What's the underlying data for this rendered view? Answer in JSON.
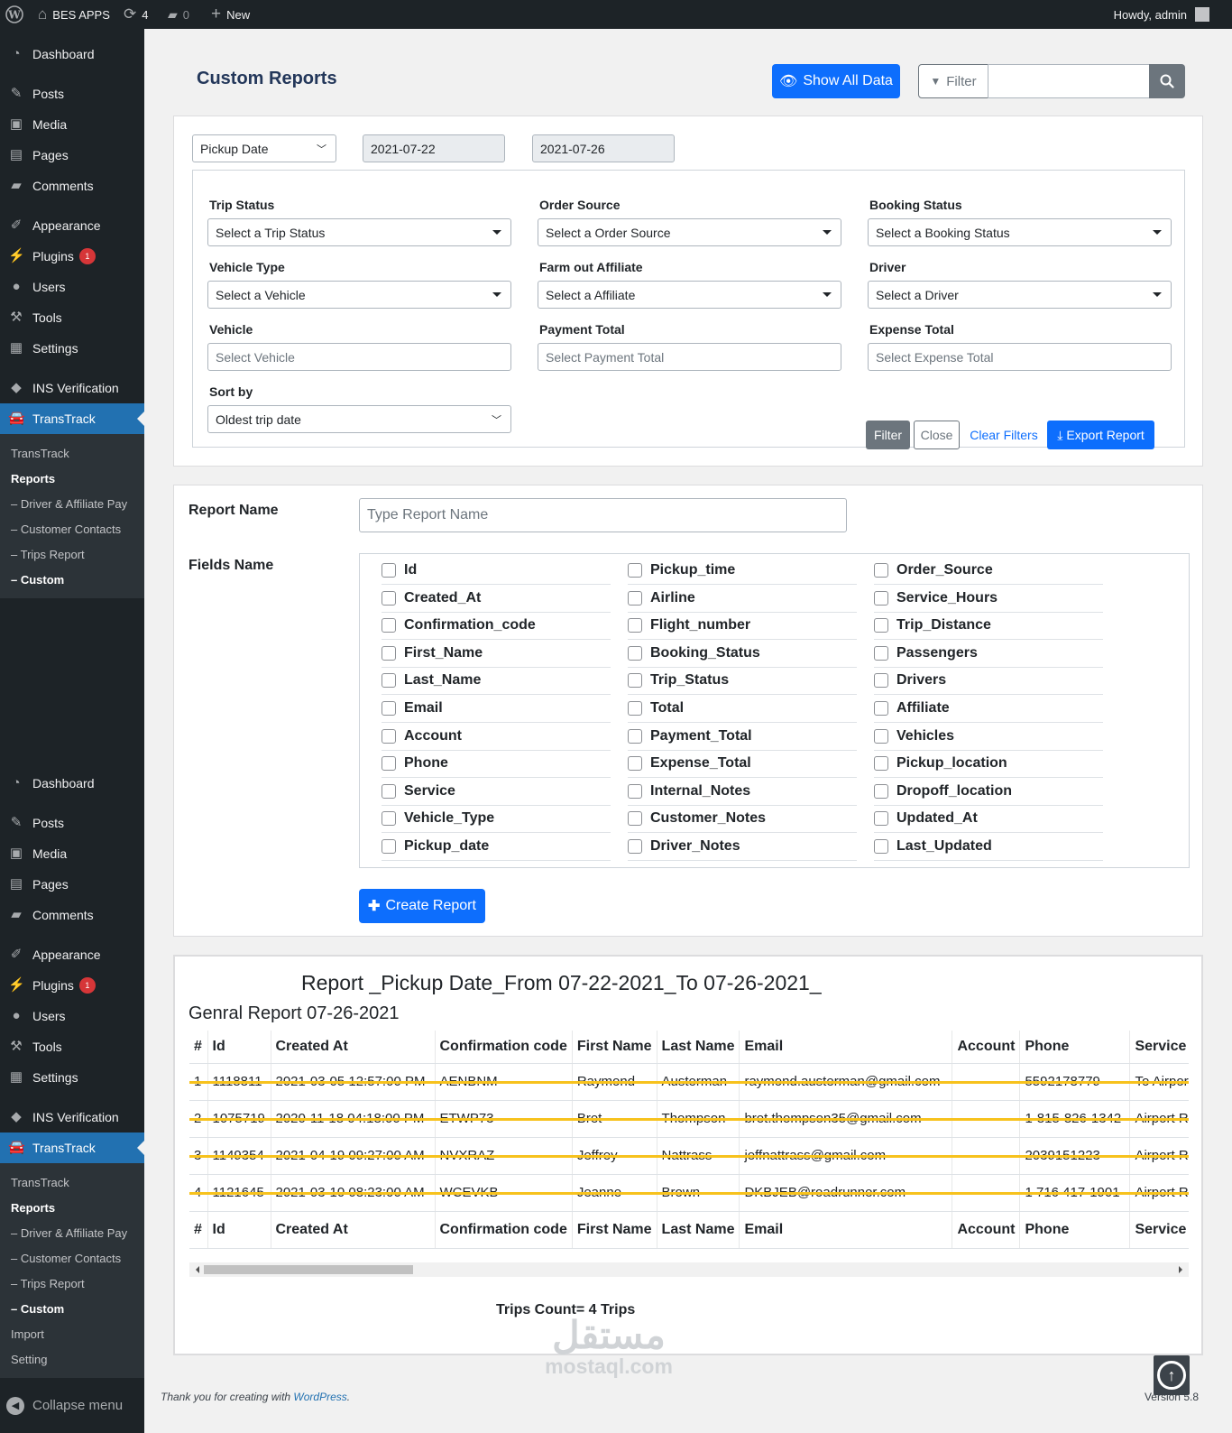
{
  "admin_bar": {
    "site_name": "BES APPS",
    "updates": "4",
    "comments": "0",
    "new_label": "New",
    "howdy": "Howdy, admin"
  },
  "sidebar": {
    "menu": [
      "Dashboard",
      "Posts",
      "Media",
      "Pages",
      "Comments",
      "Appearance",
      "Plugins",
      "Users",
      "Tools",
      "Settings",
      "INS Verification",
      "TransTrack"
    ],
    "plugins_badge": "1",
    "submenu_top": [
      "TransTrack",
      "Reports",
      "– Driver & Affiliate Pay",
      "– Customer Contacts",
      "– Trips Report",
      "– Custom"
    ],
    "submenu_bottom": [
      "TransTrack",
      "Reports",
      "– Driver & Affiliate Pay",
      "– Customer Contacts",
      "– Trips Report",
      "– Custom",
      "Import",
      "Setting"
    ],
    "collapse": "Collapse menu"
  },
  "header": {
    "title": "Custom Reports",
    "show_all": "Show All Data",
    "filter_button": "Filter",
    "search_value": ""
  },
  "filters": {
    "date_type": "Pickup Date",
    "date_from": "2021-07-22",
    "date_to": "2021-07-26",
    "fields": [
      {
        "label": "Trip Status",
        "value": "Select a Trip Status"
      },
      {
        "label": "Order Source",
        "value": "Select a Order Source"
      },
      {
        "label": "Booking Status",
        "value": "Select a Booking Status"
      },
      {
        "label": "Vehicle Type",
        "value": "Select a Vehicle"
      },
      {
        "label": "Farm out Affiliate",
        "value": "Select a Affiliate"
      },
      {
        "label": "Driver",
        "value": "Select a Driver"
      },
      {
        "label": "Vehicle",
        "value": "Select Vehicle"
      },
      {
        "label": "Payment Total",
        "value": "Select Payment Total"
      },
      {
        "label": "Expense Total",
        "value": "Select Expense Total"
      }
    ],
    "sort_label": "Sort by",
    "sort_value": "Oldest trip date",
    "buttons": {
      "filter": "Filter",
      "close": "Close",
      "clear": "Clear Filters",
      "export": "Export Report"
    }
  },
  "report_form": {
    "name_label": "Report Name",
    "name_placeholder": "Type Report Name",
    "fields_label": "Fields Name",
    "fields": [
      [
        "Id",
        "Created_At",
        "Confirmation_code",
        "First_Name",
        "Last_Name",
        "Email",
        "Account",
        "Phone",
        "Service",
        "Vehicle_Type",
        "Pickup_date"
      ],
      [
        "Pickup_time",
        "Airline",
        "Flight_number",
        "Booking_Status",
        "Trip_Status",
        "Total",
        "Payment_Total",
        "Expense_Total",
        "Internal_Notes",
        "Customer_Notes",
        "Driver_Notes"
      ],
      [
        "Order_Source",
        "Service_Hours",
        "Trip_Distance",
        "Passengers",
        "Drivers",
        "Affiliate",
        "Vehicles",
        "Pickup_location",
        "Dropoff_location",
        "Updated_At",
        "Last_Updated"
      ]
    ],
    "create_button": "Create Report"
  },
  "report": {
    "title": "Report _Pickup Date_From 07-22-2021_To 07-26-2021_",
    "subtitle": "Genral Report 07-26-2021",
    "columns": [
      "#",
      "Id",
      "Created At",
      "Confirmation code",
      "First Name",
      "Last Name",
      "Email",
      "Account",
      "Phone",
      "Service"
    ],
    "rows": [
      [
        "1",
        "1118811",
        "2021-03-05 12:57:00 PM",
        "AENBNM",
        "Raymond",
        "Austerman",
        "raymond.austerman@gmail.com",
        "",
        "5592178779",
        "To Airport"
      ],
      [
        "2",
        "1075719",
        "2020-11-18 04:18:00 PM",
        "ETWP73",
        "Bret",
        "Thompson",
        "bret.thompson35@gmail.com",
        "",
        "1-815-826-1342",
        "Airport Ro"
      ],
      [
        "3",
        "1149354",
        "2021-04-19 09:27:00 AM",
        "NVXRAZ",
        "Jeffrey",
        "Nattrass",
        "jeffnattrass@gmail.com",
        "",
        "2039151223",
        "Airport Ro"
      ],
      [
        "4",
        "1121645",
        "2021-03-10 08:23:00 AM",
        "WCEVKB",
        "Jeanne",
        "Brown",
        "DKBJEB@roadrunner.com",
        "",
        "1 716 417-1901",
        "Airport Ro"
      ]
    ],
    "trips_count": "Trips Count= 4 Trips"
  },
  "footer": {
    "text": "Thank you for creating with ",
    "link": "WordPress",
    "text_end": ".",
    "version": "Version 5.8"
  },
  "watermark": {
    "arabic": "مستقل",
    "latin": "mostaql.com"
  },
  "colors": {
    "accent": "#0d6efd",
    "wp_blue": "#2271b1",
    "highlight": "#f7c21d",
    "sidebar": "#1d2327"
  }
}
